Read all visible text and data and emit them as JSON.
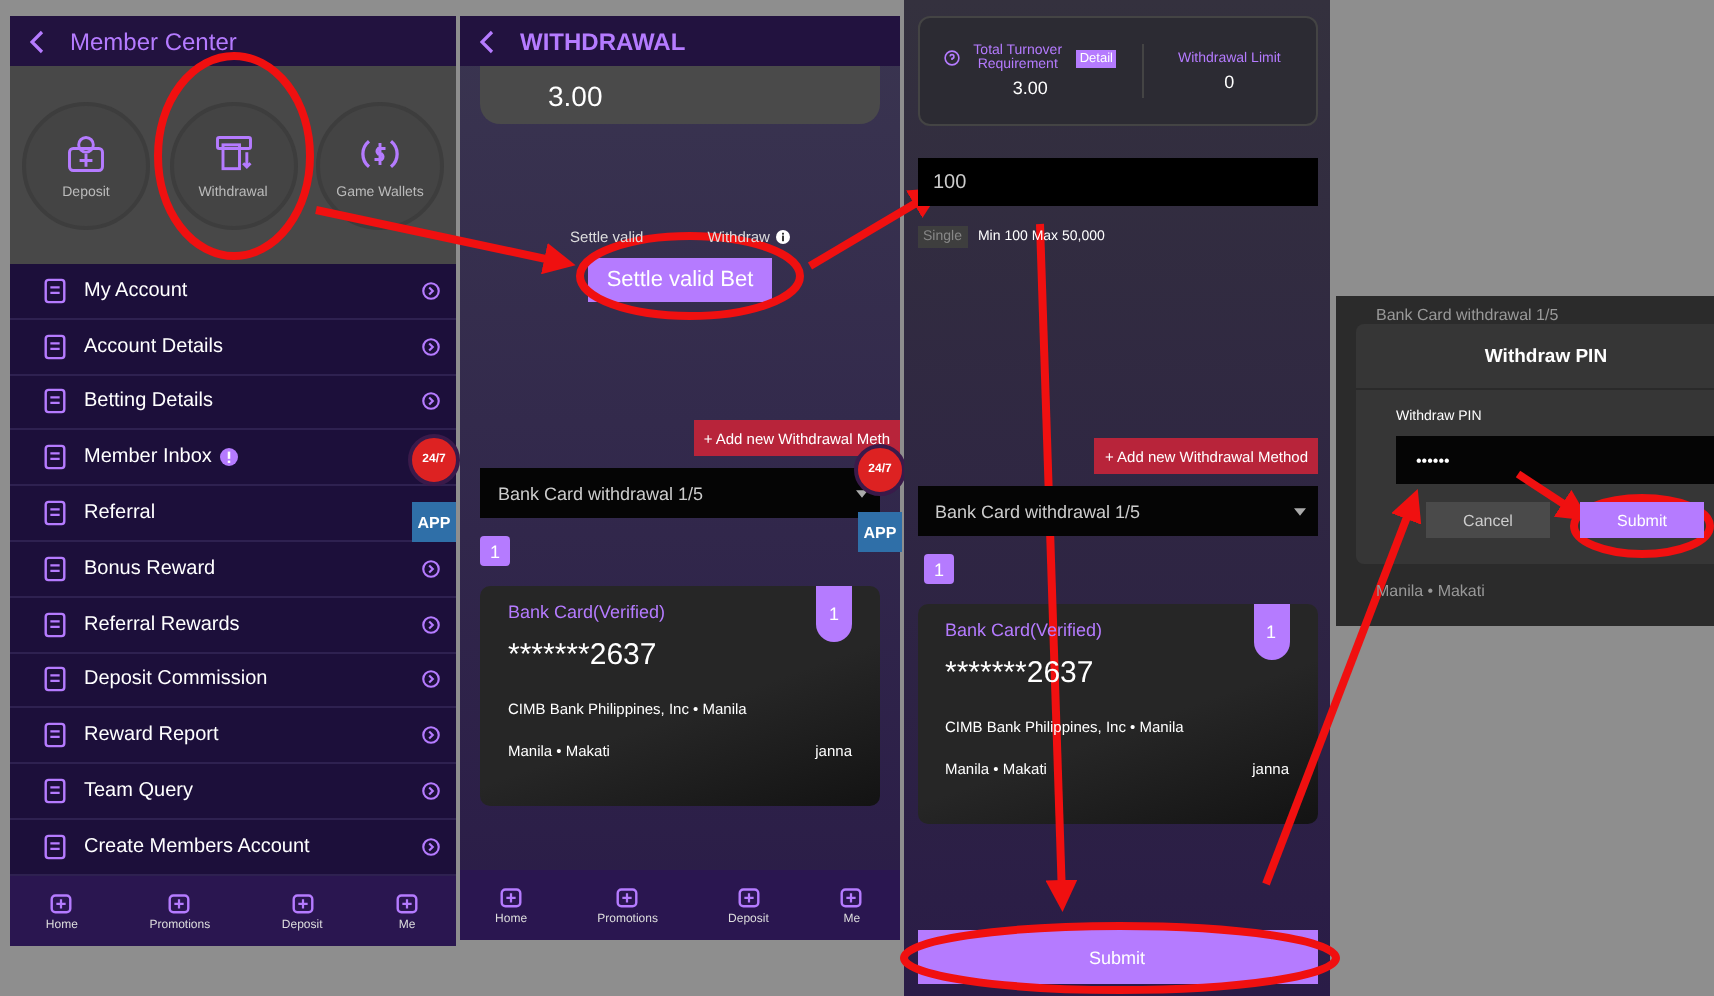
{
  "member_center": {
    "title": "Member Center",
    "shortcuts": [
      {
        "label": "Deposit",
        "kind": "deposit"
      },
      {
        "label": "Withdrawal",
        "kind": "withdrawal"
      },
      {
        "label": "Game Wallets",
        "kind": "wallets"
      }
    ],
    "menu": [
      {
        "label": "My Account",
        "chevron": true,
        "badge": false
      },
      {
        "label": "Account Details",
        "chevron": true,
        "badge": false
      },
      {
        "label": "Betting Details",
        "chevron": true,
        "badge": false
      },
      {
        "label": "Member Inbox",
        "chevron": false,
        "badge": true
      },
      {
        "label": "Referral",
        "chevron": false,
        "badge": false
      },
      {
        "label": "Bonus Reward",
        "chevron": true,
        "badge": false
      },
      {
        "label": "Referral Rewards",
        "chevron": true,
        "badge": false
      },
      {
        "label": "Deposit Commission",
        "chevron": true,
        "badge": false
      },
      {
        "label": "Reward Report",
        "chevron": true,
        "badge": false
      },
      {
        "label": "Team Query",
        "chevron": true,
        "badge": false
      },
      {
        "label": "Create Members Account",
        "chevron": true,
        "badge": false
      }
    ],
    "floating": [
      "24/7",
      "APP"
    ],
    "nav": [
      "Home",
      "Promotions",
      "Deposit",
      "Me"
    ]
  },
  "withdrawal_screen": {
    "title": "WITHDRAWAL",
    "balance": "3.00",
    "hint_start": "Settle valid",
    "hint_end": "Withdraw",
    "settle_button": "Settle valid Bet",
    "add_button": "+ Add new Withdrawal Meth",
    "select": "Bank Card withdrawal 1/5",
    "index": "1",
    "card": {
      "title": "Bank Card(Verified)",
      "number": "*******2637",
      "bank": "CIMB Bank Philippines, Inc • Manila",
      "location": "Manila • Makati",
      "holder": "janna",
      "tab": "1"
    },
    "floating": [
      "24/7",
      "APP"
    ],
    "nav": [
      "Home",
      "Promotions",
      "Deposit",
      "Me"
    ]
  },
  "withdrawal_form": {
    "turnover_label": "Total Turnover Requirement",
    "detail": "Detail",
    "turnover": "3.00",
    "limit_label": "Withdrawal Limit",
    "limit": "0",
    "amount": "100",
    "single": "Single",
    "range": "Min 100 Max 50,000",
    "add_button": "+ Add new Withdrawal Method",
    "select": "Bank Card withdrawal 1/5",
    "index": "1",
    "card": {
      "title": "Bank Card(Verified)",
      "number": "*******2637",
      "bank": "CIMB Bank Philippines, Inc • Manila",
      "location": "Manila • Makati",
      "holder": "janna",
      "tab": "1"
    },
    "submit": "Submit"
  },
  "pin_dialog": {
    "behind_top": "Bank Card withdrawal 1/5",
    "title": "Withdraw PIN",
    "label": "Withdraw PIN",
    "value": "••••••",
    "cancel": "Cancel",
    "submit": "Submit",
    "behind_bottom": "Manila • Makati"
  }
}
